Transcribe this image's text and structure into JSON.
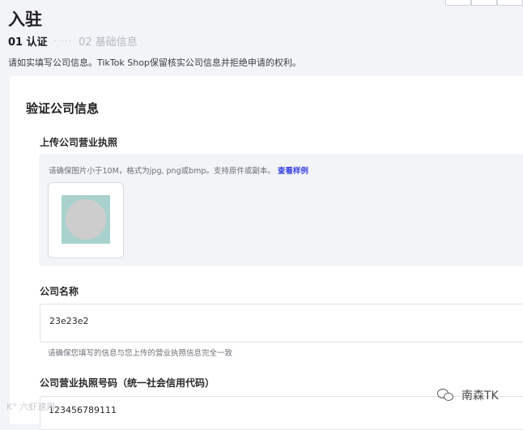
{
  "page": {
    "title": "入驻",
    "steps": [
      {
        "label": "01 认证",
        "active": true
      },
      {
        "label": "02 基础信息",
        "active": false
      }
    ],
    "step_dots": "·····",
    "intro": "请如实填写公司信息。TikTok Shop保留核实公司信息并拒绝申请的权利。"
  },
  "card": {
    "title": "验证公司信息",
    "upload": {
      "label": "上传公司营业执照",
      "hint": "请确保图片小于10M，格式为jpg, png或bmp。支持原件或副本。",
      "sample_link": "查看样例"
    },
    "company_name": {
      "label": "公司名称",
      "value": "23e23e2",
      "helper": "请确保您填写的信息与您上传的营业执照信息完全一致"
    },
    "license_number": {
      "label": "公司营业执照号码（统一社会信用代码）",
      "value": "123456789111"
    }
  },
  "watermarks": {
    "left": "K° 六虾速用",
    "right": "南森TK"
  },
  "colors": {
    "background": "#f3f4f8",
    "link": "#3b47e0",
    "thumbnail": "#a9d2cf"
  }
}
